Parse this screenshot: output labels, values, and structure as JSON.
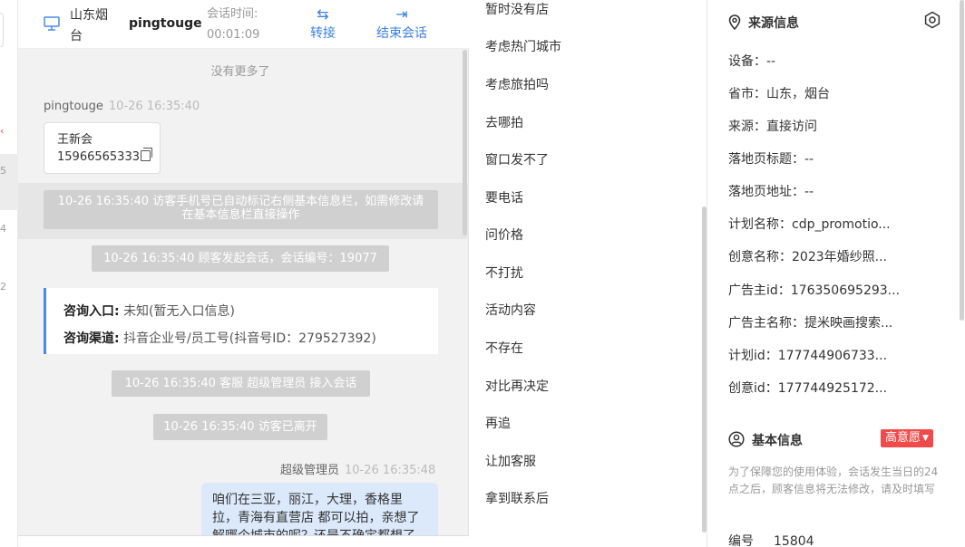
{
  "left_strip": {
    "marks": [
      "5",
      "4",
      "2"
    ]
  },
  "header": {
    "location": "山东烟台",
    "username": "pingtouge",
    "duration_label": "会话时间:",
    "duration": "00:01:09",
    "transfer_label": "转接",
    "end_label": "结束会话"
  },
  "chat": {
    "no_more": "没有更多了",
    "visitor_name": "pingtouge",
    "visitor_time": "10-26 16:35:40",
    "card_name": "王新会",
    "card_phone": "15966565333",
    "sys_auto_mark": "10-26 16:35:40 访客手机号已自动标记右侧基本信息栏，如需修改请在基本信息栏直接操作",
    "sys_start": "10-26 16:35:40 顾客发起会话，会话编号：19077",
    "entry_label": "咨询入口:",
    "entry_value": "未知(暂无入口信息)",
    "channel_label": "咨询渠道:",
    "channel_value": "抖音企业号/员工号(抖音号ID：279527392)",
    "sys_accept": "10-26 16:35:40 客服 超级管理员 接入会话",
    "sys_left": "10-26 16:35:40 访客已离开",
    "agent_name": "超级管理员",
    "agent_time": "10-26 16:35:48",
    "agent_message": "咱们在三亚，丽江，大理，香格里拉，青海有直营店 都可以拍，亲想了解哪个城市的呢？还是不确定都想了解下呢？"
  },
  "quick_replies": [
    "暂时没有店",
    "考虑热门城市",
    "考虑旅拍吗",
    "去哪拍",
    "窗口发不了",
    "要电话",
    "问价格",
    "不打扰",
    "活动内容",
    "不存在",
    "对比再决定",
    "再追",
    "让加客服",
    "拿到联系后"
  ],
  "source": {
    "title": "来源信息",
    "rows": [
      "设备：--",
      "省市：山东，烟台",
      "来源：直接访问",
      "落地页标题：--",
      "落地页地址：--",
      "计划名称：cdp_promotio...",
      "创意名称：2023年婚纱照...",
      "广告主id：176350695293...",
      "广告主名称：提米映画搜索...",
      "计划id：177744906733...",
      "创意id：177744925172..."
    ]
  },
  "basic": {
    "title": "基本信息",
    "intent_badge": "高意愿",
    "notice": "为了保障您的使用体验，会话发生当日的24点之后，顾客信息将无法修改，请及时填写",
    "id_label": "编号",
    "id_value": "15804"
  },
  "colors": {
    "accent": "#3a7fe0",
    "badge": "#f04a4a",
    "bubble": "#dbe9fb",
    "entry_bar": "#4a8ae8"
  }
}
